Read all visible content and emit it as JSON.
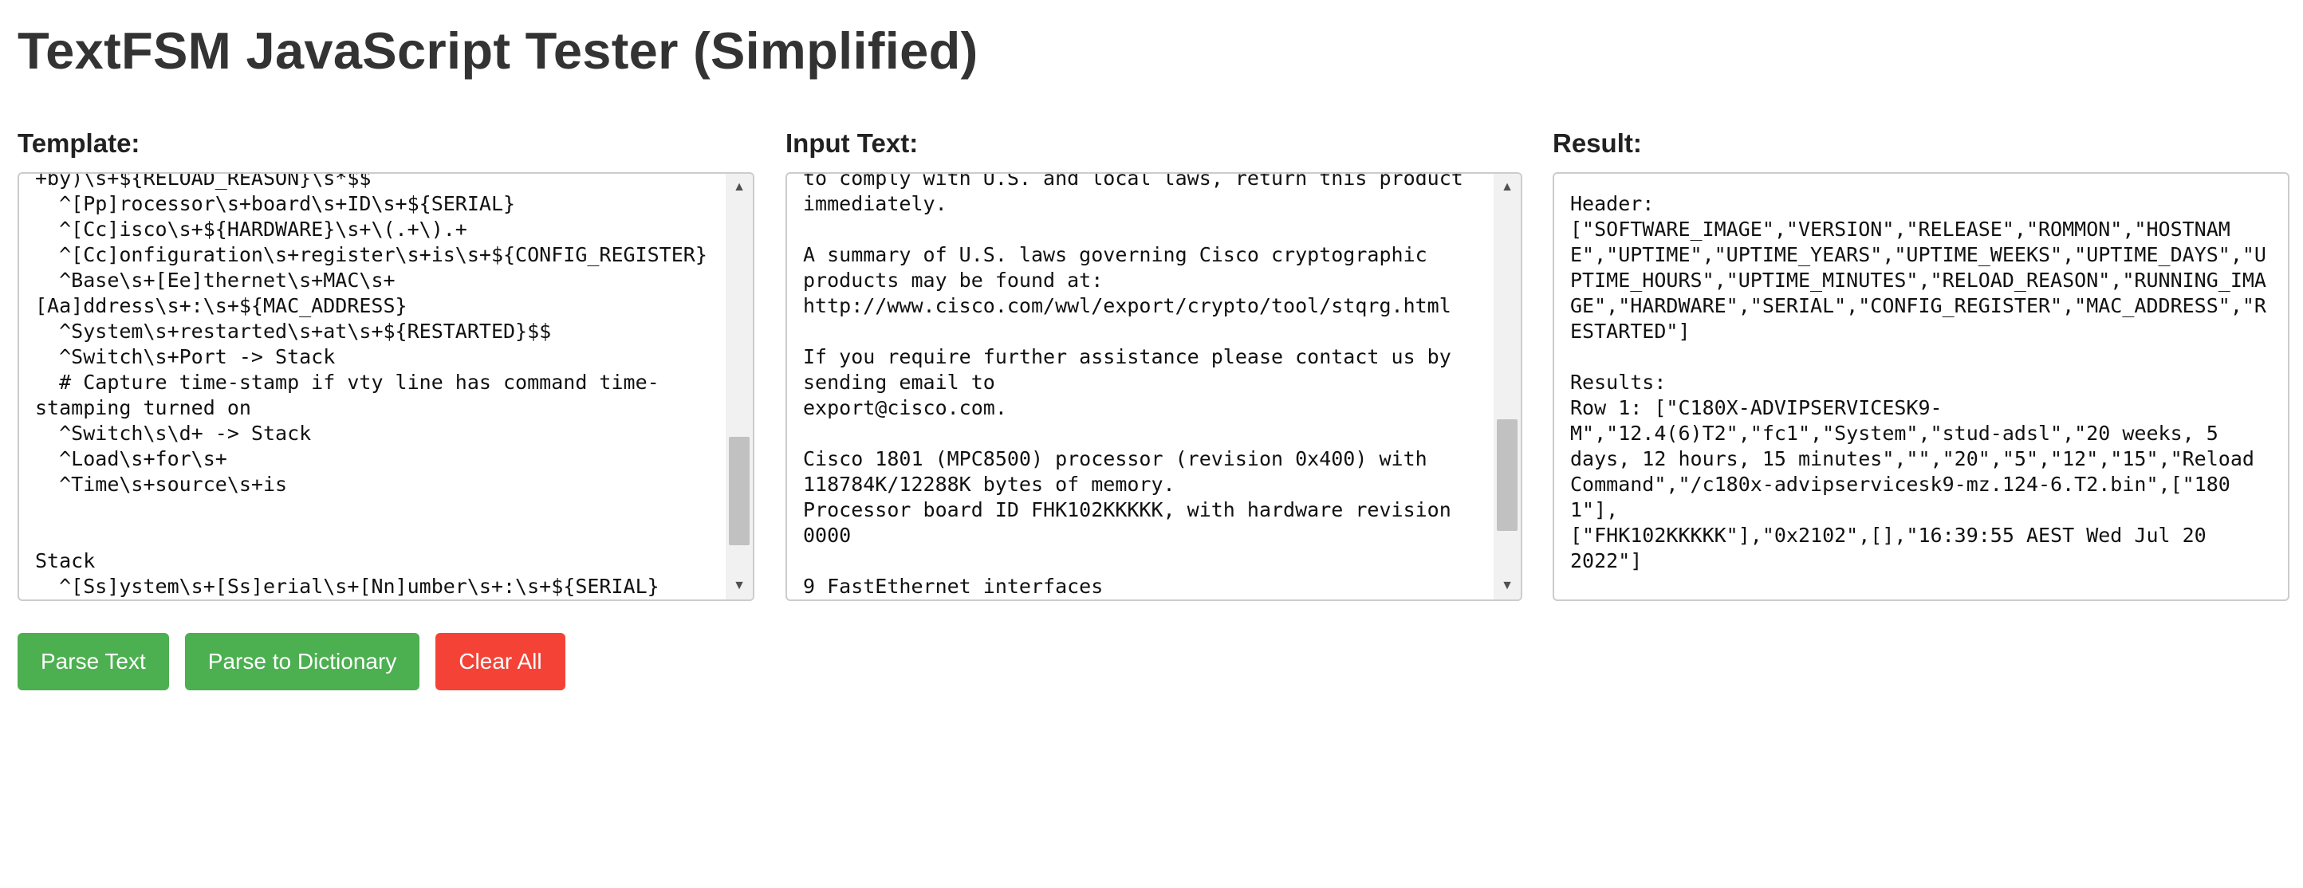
{
  "title": "TextFSM JavaScript Tester (Simplified)",
  "colors": {
    "primary_button": "#4caf50",
    "danger_button": "#f44336",
    "border": "#cccccc"
  },
  "template_panel": {
    "label": "Template:",
    "value": "+by)\\s+${RELOAD_REASON}\\s*$$\n  ^[Pp]rocessor\\s+board\\s+ID\\s+${SERIAL}\n  ^[Cc]isco\\s+${HARDWARE}\\s+\\(.+\\).+\n  ^[Cc]onfiguration\\s+register\\s+is\\s+${CONFIG_REGISTER}\n  ^Base\\s+[Ee]thernet\\s+MAC\\s+\n[Aa]ddress\\s+:\\s+${MAC_ADDRESS}\n  ^System\\s+restarted\\s+at\\s+${RESTARTED}$$\n  ^Switch\\s+Port -> Stack\n  # Capture time-stamp if vty line has command time-\nstamping turned on\n  ^Switch\\s\\d+ -> Stack\n  ^Load\\s+for\\s+\n  ^Time\\s+source\\s+is\n\n\nStack\n  ^[Ss]ystem\\s+[Ss]erial\\s+[Nn]umber\\s+:\\s+${SERIAL}"
  },
  "input_panel": {
    "label": "Input Text:",
    "value": "to comply with U.S. and local laws, return this product\nimmediately.\n\nA summary of U.S. laws governing Cisco cryptographic\nproducts may be found at:\nhttp://www.cisco.com/wwl/export/crypto/tool/stqrg.html\n\nIf you require further assistance please contact us by\nsending email to\nexport@cisco.com.\n\nCisco 1801 (MPC8500) processor (revision 0x400) with\n118784K/12288K bytes of memory.\nProcessor board ID FHK102KKKKK, with hardware revision\n0000\n\n9 FastEthernet interfaces"
  },
  "result_panel": {
    "label": "Result:",
    "value": "Header:\n[\"SOFTWARE_IMAGE\",\"VERSION\",\"RELEASE\",\"ROMMON\",\"HOSTNAME\",\"UPTIME\",\"UPTIME_YEARS\",\"UPTIME_WEEKS\",\"UPTIME_DAYS\",\"UPTIME_HOURS\",\"UPTIME_MINUTES\",\"RELOAD_REASON\",\"RUNNING_IMAGE\",\"HARDWARE\",\"SERIAL\",\"CONFIG_REGISTER\",\"MAC_ADDRESS\",\"RESTARTED\"]\n\nResults:\nRow 1: [\"C180X-ADVIPSERVICESK9-\nM\",\"12.4(6)T2\",\"fc1\",\"System\",\"stud-adsl\",\"20 weeks, 5\ndays, 12 hours, 15 minutes\",\"\",\"20\",\"5\",\"12\",\"15\",\"Reload\nCommand\",\"/c180x-advipservicesk9-mz.124-6.T2.bin\",[\"1801\"],\n[\"FHK102KKKKK\"],\"0x2102\",[],\"16:39:55 AEST Wed Jul 20\n2022\"]"
  },
  "buttons": {
    "parse_text": "Parse Text",
    "parse_to_dictionary": "Parse to Dictionary",
    "clear_all": "Clear All"
  }
}
